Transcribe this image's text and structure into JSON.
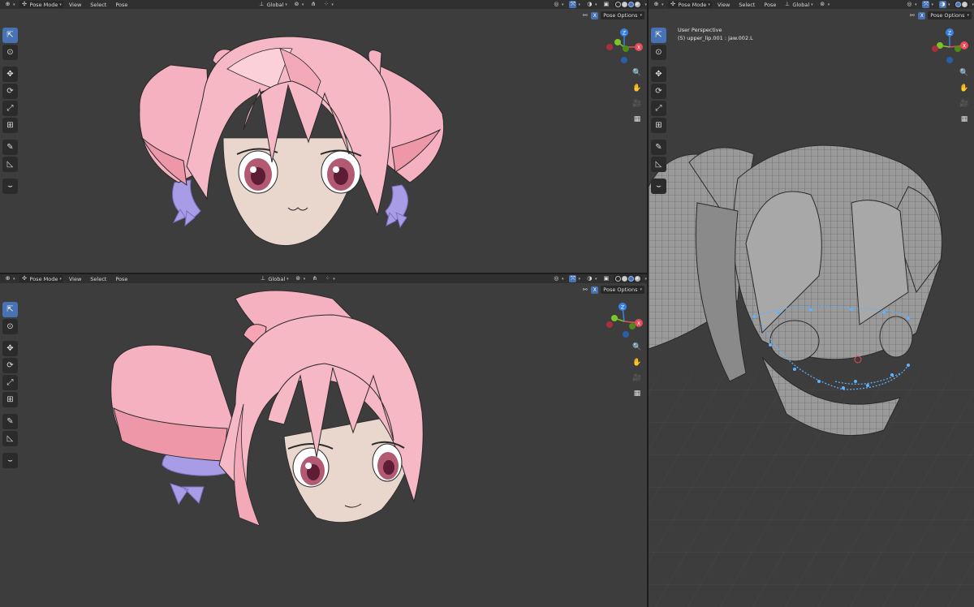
{
  "header": {
    "mode_label": "Pose Mode",
    "menus": [
      "View",
      "Select",
      "Pose"
    ],
    "orientation": "Global",
    "pose_options": "Pose Options"
  },
  "right_viewport": {
    "perspective": "User Perspective",
    "selection": "(5) upper_lip.001 : jaw.002.L"
  },
  "icons": {
    "editor_type": "globe-cursor-icon",
    "mode": "pose-icon",
    "transform_pivot": "pivot-icon",
    "snap": "magnet-icon",
    "overlays": "overlay-icon",
    "xray": "xray-icon"
  },
  "colors": {
    "viewport_bg": "#3d3d3d",
    "header_bg": "#303030",
    "accent_blue": "#4772b3",
    "axis_x": "#e74c5b",
    "axis_y": "#7dc32a",
    "axis_z": "#3a82e0",
    "hair_pink": "#f7b6c3",
    "bow_purple": "#a89ce6",
    "skin": "#e9d6cc"
  }
}
